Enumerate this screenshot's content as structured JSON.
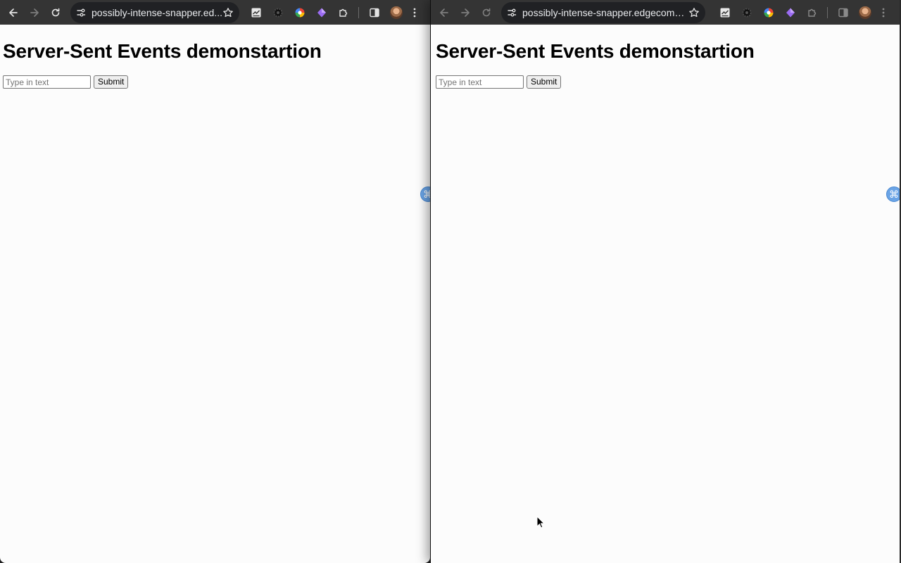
{
  "left_window": {
    "url": "possibly-intense-snapper.ed...",
    "page": {
      "heading": "Server-Sent Events demonstartion",
      "input_placeholder": "Type in text",
      "submit_label": "Submit"
    },
    "sidebar_tab_glyph": "⌘"
  },
  "right_window": {
    "url": "possibly-intense-snapper.edgecompu...",
    "page": {
      "heading": "Server-Sent Events demonstartion",
      "input_placeholder": "Type in text",
      "submit_label": "Submit"
    },
    "sidebar_tab_glyph": "⌘"
  },
  "colors": {
    "toolbar": "#343434",
    "omnibox": "#202124",
    "page_background": "#fcfcfc"
  },
  "icons": [
    "back-arrow-icon",
    "forward-arrow-icon",
    "reload-icon",
    "site-info-icon",
    "bookmark-star-icon",
    "extension-chart-icon",
    "extension-gear-icon",
    "extension-color-wheel-icon",
    "extension-diamond-icon",
    "extensions-puzzle-icon",
    "side-panel-icon",
    "profile-avatar",
    "menu-dots-icon"
  ]
}
